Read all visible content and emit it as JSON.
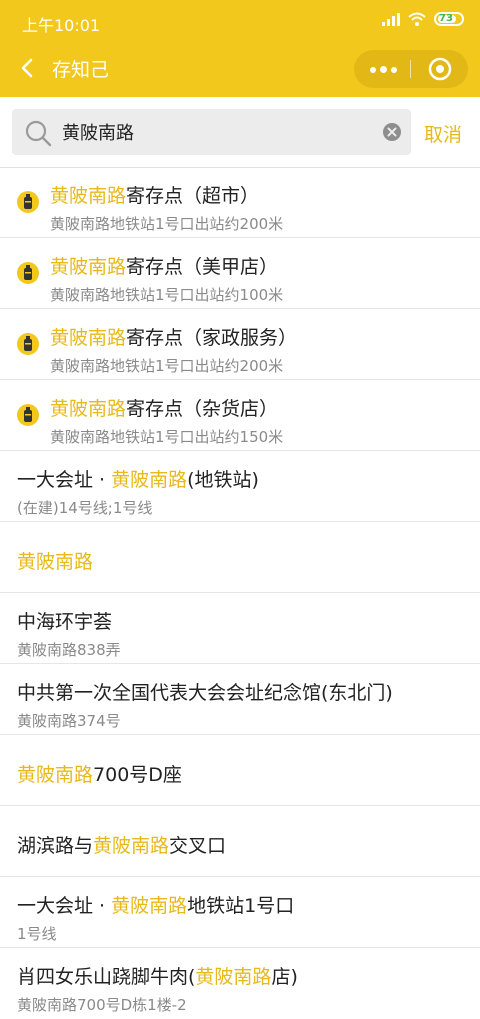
{
  "status_bar": {
    "time": "上午10:01",
    "battery": "73"
  },
  "nav": {
    "title": "存知己"
  },
  "search": {
    "value": "黄陂南路",
    "cancel_label": "取消"
  },
  "colors": {
    "brand": "#f3c81c",
    "highlight": "#e8b91a",
    "subtext": "#8a8a8a"
  },
  "results": [
    {
      "pre": "",
      "hl": "黄陂南路",
      "post": "寄存点（超市）",
      "sub": "黄陂南路地铁站1号口出站约200米",
      "icon": "luggage-pin-icon"
    },
    {
      "pre": "",
      "hl": "黄陂南路",
      "post": "寄存点（美甲店）",
      "sub": "黄陂南路地铁站1号口出站约100米",
      "icon": "luggage-pin-icon"
    },
    {
      "pre": "",
      "hl": "黄陂南路",
      "post": "寄存点（家政服务）",
      "sub": "黄陂南路地铁站1号口出站约200米",
      "icon": "luggage-pin-icon"
    },
    {
      "pre": "",
      "hl": "黄陂南路",
      "post": "寄存点（杂货店）",
      "sub": "黄陂南路地铁站1号口出站约150米",
      "icon": "luggage-pin-icon"
    },
    {
      "pre": "一大会址 · ",
      "hl": "黄陂南路",
      "post": "(地铁站)",
      "sub": "(在建)14号线;1号线"
    },
    {
      "pre": "",
      "hl": "黄陂南路",
      "post": "",
      "sub": ""
    },
    {
      "pre": "中海环宇荟",
      "hl": "",
      "post": "",
      "sub": "黄陂南路838弄"
    },
    {
      "pre": "中共第一次全国代表大会会址纪念馆(东北门)",
      "hl": "",
      "post": "",
      "sub": "黄陂南路374号"
    },
    {
      "pre": "",
      "hl": "黄陂南路",
      "post": "700号D座",
      "sub": ""
    },
    {
      "pre": "湖滨路与",
      "hl": "黄陂南路",
      "post": "交叉口",
      "sub": ""
    },
    {
      "pre": "一大会址 · ",
      "hl": "黄陂南路",
      "post": "地铁站1号口",
      "sub": "1号线"
    },
    {
      "pre": "肖四女乐山跷脚牛肉(",
      "hl": "黄陂南路",
      "post": "店)",
      "sub": "黄陂南路700号D栋1楼-2"
    }
  ]
}
